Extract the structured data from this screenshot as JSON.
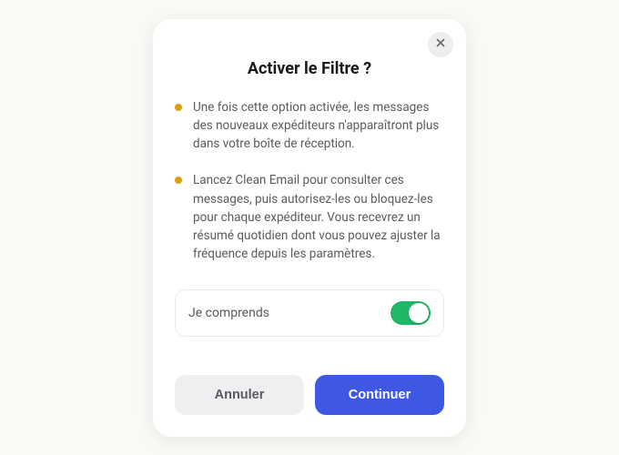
{
  "modal": {
    "title": "Activer le Filtre ?",
    "bullets": [
      "Une fois cette option activée, les messages des nouveaux expéditeurs n'apparaîtront plus dans votre boîte de réception.",
      "Lancez Clean Email pour consulter ces messages, puis autorisez-les ou bloquez-les pour chaque expéditeur. Vous recevrez un résumé quotidien dont vous pouvez ajuster la fréquence depuis les paramètres."
    ],
    "consent": {
      "label": "Je comprends",
      "enabled": true
    },
    "buttons": {
      "cancel": "Annuler",
      "continue": "Continuer"
    },
    "colors": {
      "accent": "#3f58e3",
      "bullet": "#e49b0f",
      "toggle_on": "#1fb866"
    }
  }
}
